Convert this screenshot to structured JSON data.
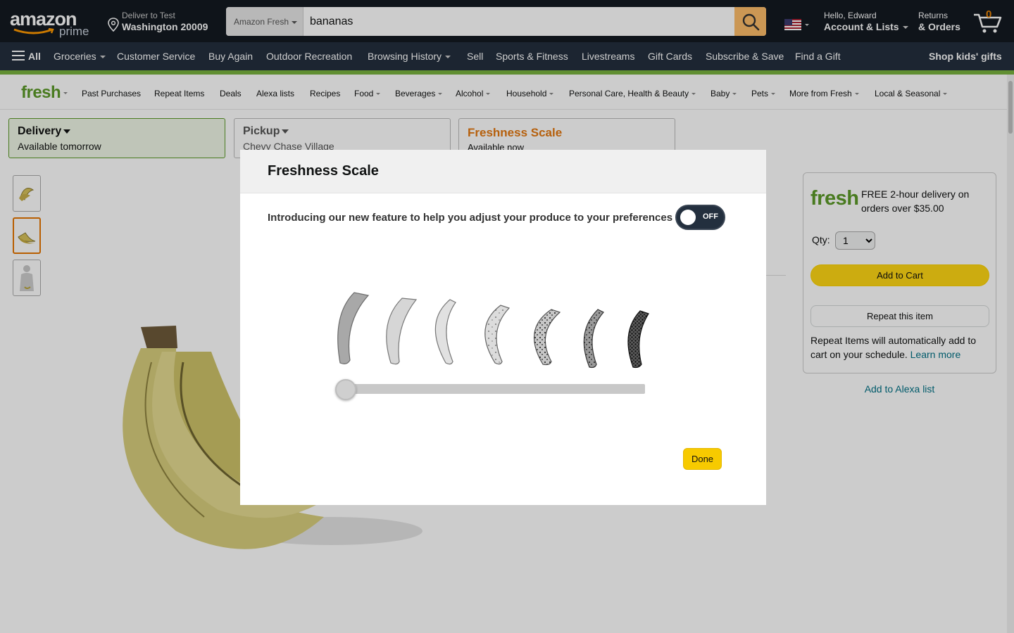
{
  "header": {
    "logo_text": "amazon",
    "logo_sub": "prime",
    "deliver_line1": "Deliver to Test",
    "deliver_line2": "Washington 20009",
    "search_category": "Amazon Fresh",
    "search_value": "bananas",
    "account_line1": "Hello, Edward",
    "account_line2": "Account & Lists",
    "orders_line1": "Returns",
    "orders_line2": "& Orders",
    "cart_count": "0"
  },
  "main_nav": {
    "all_label": "All",
    "items": [
      "Groceries",
      "Customer Service",
      "Buy Again",
      "Outdoor Recreation",
      "Browsing History",
      "Sell",
      "Sports & Fitness",
      "Livestreams",
      "Gift Cards",
      "Subscribe & Save",
      "Find a Gift"
    ],
    "promo": "Shop kids' gifts"
  },
  "fresh_nav": {
    "logo": "fresh",
    "items": [
      "Past Purchases",
      "Repeat Items",
      "Deals",
      "Alexa lists",
      "Recipes",
      "Food",
      "Beverages",
      "Alcohol",
      "Household",
      "Personal Care, Health & Beauty",
      "Baby",
      "Pets",
      "More from Fresh",
      "Local & Seasonal"
    ]
  },
  "options": [
    {
      "title": "Delivery",
      "subtitle": "Available tomorrow"
    },
    {
      "title": "Pickup",
      "subtitle": "Chevy Chase Village"
    },
    {
      "title": "Freshness Scale",
      "subtitle": "Available now"
    }
  ],
  "buybox": {
    "logo": "fresh",
    "delivery_desc": "FREE 2-hour delivery on orders over $35.00",
    "qty_label": "Qty:",
    "qty_value": "1",
    "add_to_cart": "Add to Cart",
    "repeat_item": "Repeat this item",
    "repeat_note": "Repeat Items will automatically add to cart on your schedule.",
    "learn_more": "Learn more",
    "alexa_link": "Add to Alexa list"
  },
  "modal": {
    "title": "Freshness Scale",
    "intro": "Introducing our new feature to help you adjust your produce to your preferences",
    "toggle_label": "OFF",
    "slider_value": 0,
    "done_label": "Done"
  },
  "colors": {
    "nav_dark": "#131921",
    "nav_secondary": "#232f3e",
    "fresh_green": "#5c9a28",
    "cart_yellow": "#ffd814",
    "search_button": "#febd69",
    "freshness_orange": "#e47911"
  }
}
